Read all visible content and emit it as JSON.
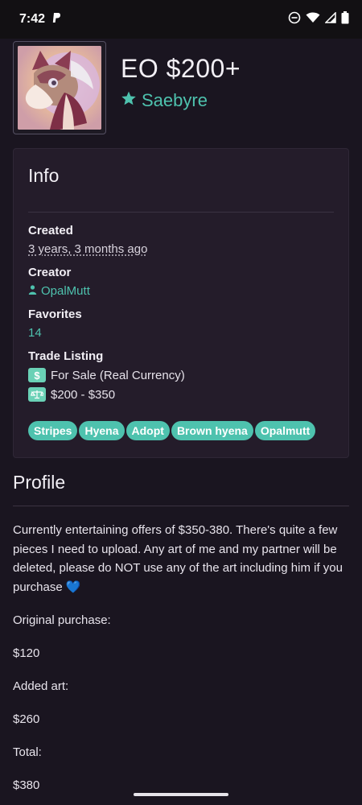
{
  "status": {
    "time": "7:42"
  },
  "header": {
    "title": "EO $200+",
    "owner": "Saebyre"
  },
  "info": {
    "title": "Info",
    "created_label": "Created",
    "created_value": "3 years, 3 months ago",
    "creator_label": "Creator",
    "creator_value": "OpalMutt",
    "favorites_label": "Favorites",
    "favorites_value": "14",
    "trade_label": "Trade Listing",
    "trade_type": "For Sale (Real Currency)",
    "trade_range": "$200 - $350",
    "tags": [
      "Stripes",
      "Hyena",
      "Adopt",
      "Brown hyena",
      "Opalmutt"
    ]
  },
  "profile": {
    "title": "Profile",
    "paragraph": "Currently entertaining offers of $350-380. There's quite a few pieces I need to upload. Any art of me and my partner will be deleted, please do NOT use any of the art including him if you purchase 💙",
    "line1": "Original purchase:",
    "line2": "$120",
    "line3": "Added art:",
    "line4": "$260",
    "line5": "Total:",
    "line6": "$380"
  },
  "icons": {
    "paypal": "paypal-icon",
    "dnd": "do-not-disturb-icon",
    "wifi": "wifi-icon",
    "signal": "signal-icon",
    "battery": "battery-icon",
    "star": "star-icon",
    "user": "user-icon",
    "dollar": "dollar-icon",
    "scale": "scale-icon"
  },
  "colors": {
    "accent": "#4ec2ae",
    "background": "#1a1520",
    "card": "#241c2a"
  }
}
